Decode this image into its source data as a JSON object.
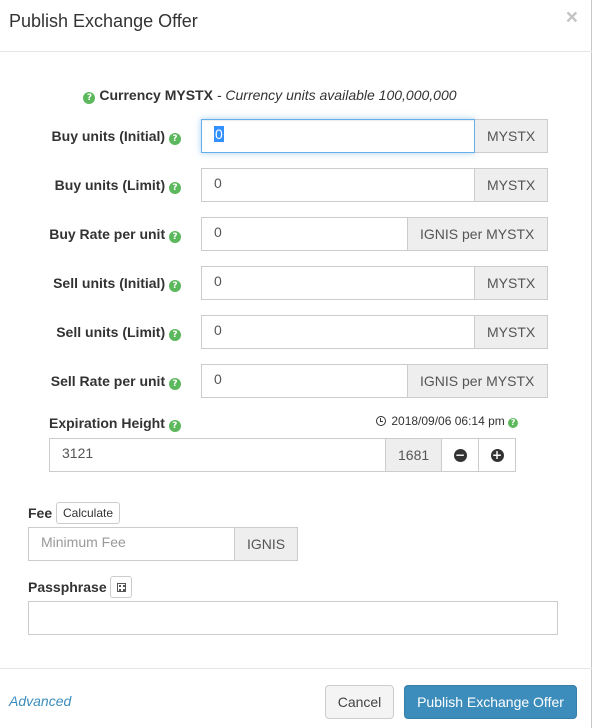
{
  "modal": {
    "title": "Publish Exchange Offer",
    "close_glyph": "×"
  },
  "currency": {
    "label": "Currency MYSTX",
    "available_text": "- Currency units available 100,000,000"
  },
  "rows": [
    {
      "label": "Buy units (Initial)",
      "value": "0",
      "unit": "MYSTX"
    },
    {
      "label": "Buy units (Limit)",
      "value": "0",
      "unit": "MYSTX"
    },
    {
      "label": "Buy Rate per unit",
      "value": "0",
      "unit": "IGNIS per MYSTX"
    },
    {
      "label": "Sell units (Initial)",
      "value": "0",
      "unit": "MYSTX"
    },
    {
      "label": "Sell units (Limit)",
      "value": "0",
      "unit": "MYSTX"
    },
    {
      "label": "Sell Rate per unit",
      "value": "0",
      "unit": "IGNIS per MYSTX"
    }
  ],
  "expiration": {
    "label": "Expiration Height",
    "time": "2018/09/06 06:14 pm",
    "value": "3121",
    "delta": "1681"
  },
  "fee": {
    "label": "Fee",
    "calculate_label": "Calculate",
    "placeholder": "Minimum Fee",
    "unit": "IGNIS"
  },
  "passphrase": {
    "label": "Passphrase",
    "value": ""
  },
  "footer": {
    "advanced_label": "Advanced",
    "cancel_label": "Cancel",
    "submit_label": "Publish Exchange Offer"
  },
  "icons": {
    "help": "question-circle-icon",
    "clock": "clock-icon",
    "minus": "minus-circle-icon",
    "plus": "plus-circle-icon",
    "qr": "qrcode-icon"
  },
  "colors": {
    "help_green": "#5cb85c",
    "primary": "#3c8dbc",
    "focus_border": "#66afe9"
  }
}
